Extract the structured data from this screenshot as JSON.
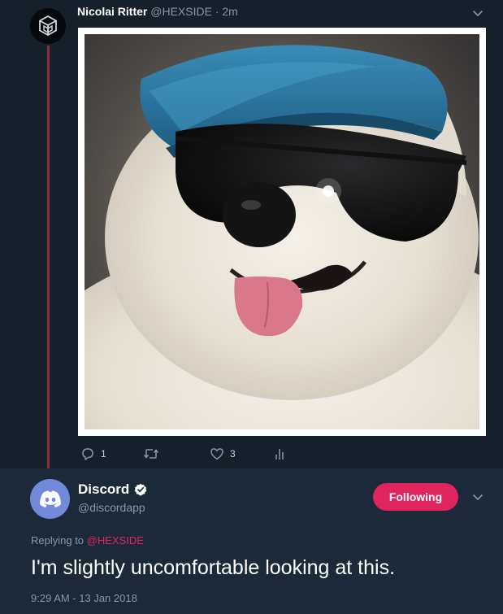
{
  "parent_tweet": {
    "author_name": "Nicolai Ritter",
    "handle": "@HEXSIDE",
    "separator": "·",
    "time": "2m",
    "actions": {
      "reply_count": "1",
      "like_count": "3"
    },
    "icons": [
      "hexside-logo-icon",
      "chevron-down-icon",
      "reply-icon",
      "retweet-icon",
      "like-icon",
      "analytics-icon"
    ]
  },
  "main_tweet": {
    "author_name": "Discord",
    "handle": "@discordapp",
    "follow_label": "Following",
    "replying_prefix": "Replying to",
    "replying_mention": "@HEXSIDE",
    "text": "I'm slightly uncomfortable looking at this.",
    "timestamp": "9:29 AM - 13 Jan 2018",
    "icons": [
      "discord-logo-icon",
      "verified-badge-icon",
      "chevron-down-icon"
    ]
  },
  "colors": {
    "background": "#15202b",
    "main_tweet_bg": "#1c2938",
    "thread_line": "#8a2f3a",
    "following_button": "#e0245e",
    "mention": "#e0245e",
    "discord_blurple": "#7289da",
    "secondary_text": "#8899a6"
  }
}
